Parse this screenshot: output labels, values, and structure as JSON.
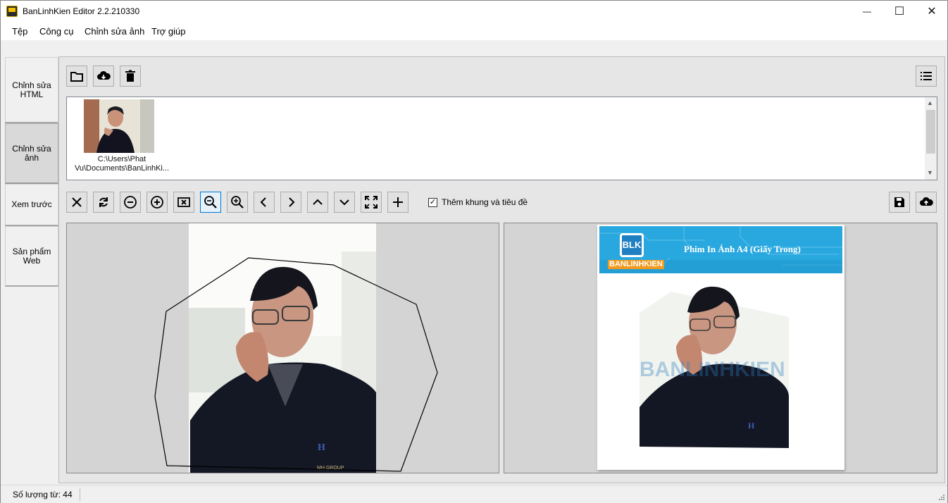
{
  "window": {
    "title": "BanLinhKien Editor 2.2.210330",
    "minimize_glyph": "—",
    "maximize_glyph": "☐",
    "close_glyph": "✕"
  },
  "menu": [
    "Tệp",
    "Công cụ",
    "Chỉnh sửa ảnh",
    "Trợ giúp"
  ],
  "tabs": [
    {
      "label": "Chỉnh sửa HTML",
      "active": false
    },
    {
      "label": "Chỉnh sửa ảnh",
      "active": true
    },
    {
      "label": "Xem trước",
      "active": false
    },
    {
      "label": "Sản phẩm Web",
      "active": false
    }
  ],
  "toolbar_top": [
    "folder-open-icon",
    "cloud-download-icon",
    "trash-icon",
    "list-view-icon"
  ],
  "file_list": {
    "items": [
      {
        "label_line1": "C:\\Users\\Phat",
        "label_line2": "Vu\\Documents\\BanLinhKi..."
      }
    ]
  },
  "edit_toolbar": [
    "close-icon",
    "rotate-icon",
    "zoom-minus-circle-icon",
    "zoom-plus-circle-icon",
    "delete-box-icon",
    "zoom-out-icon",
    "zoom-in-icon",
    "arrow-left-icon",
    "arrow-right-icon",
    "arrow-up-icon",
    "arrow-down-icon",
    "fit-screen-icon",
    "add-icon",
    "save-icon",
    "cloud-upload-icon"
  ],
  "add_frame": {
    "label": "Thêm khung và tiêu đề",
    "checked": true,
    "check_glyph": "✓"
  },
  "preview": {
    "brand": "BANLINHKIEN",
    "logo_text": "BLK",
    "title": "Phim In Ảnh A4 (Giấy Trong)",
    "watermark": "BANLINHKIEN",
    "shirt_text": "MH GROUP"
  },
  "status": {
    "word_count": "Số lượng từ: 44"
  },
  "colors": {
    "header_blue": "#29a8df",
    "brand_orange": "#f39a1e",
    "selected_border": "#0078d7"
  }
}
